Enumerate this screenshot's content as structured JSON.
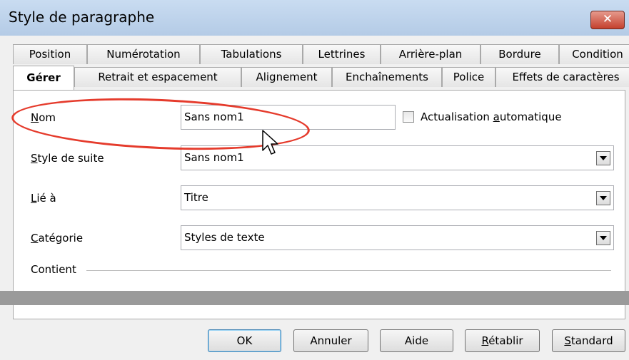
{
  "window": {
    "title": "Style de paragraphe",
    "close_label": "✕"
  },
  "tabs_row1": [
    "Position",
    "Numérotation",
    "Tabulations",
    "Lettrines",
    "Arrière-plan",
    "Bordure",
    "Condition"
  ],
  "tabs_row2": [
    "Gérer",
    "Retrait et espacement",
    "Alignement",
    "Enchaînements",
    "Police",
    "Effets de caractères"
  ],
  "active_tab": "Gérer",
  "form": {
    "name": {
      "mnemonic": "N",
      "rest": "om",
      "value": "Sans nom1"
    },
    "auto_update": {
      "pre": "Actualisation ",
      "mnemonic": "a",
      "post": "utomatique",
      "checked": false
    },
    "next_style": {
      "mnemonic": "S",
      "rest": "tyle de suite",
      "value": "Sans nom1"
    },
    "linked_to": {
      "mnemonic": "L",
      "rest": "ié à",
      "value": "Titre"
    },
    "category": {
      "mnemonic": "C",
      "rest": "atégorie",
      "value": "Styles de texte"
    },
    "contains_label": "Contient"
  },
  "buttons": {
    "ok": "OK",
    "cancel": "Annuler",
    "help": "Aide",
    "reset_mnemonic": "R",
    "reset_rest": "établir",
    "standard_mnemonic": "S",
    "standard_rest": "tandard"
  },
  "colors": {
    "annotation": "#e53b2c",
    "titlebar": "#c9dcf1",
    "close": "#c4402d"
  }
}
